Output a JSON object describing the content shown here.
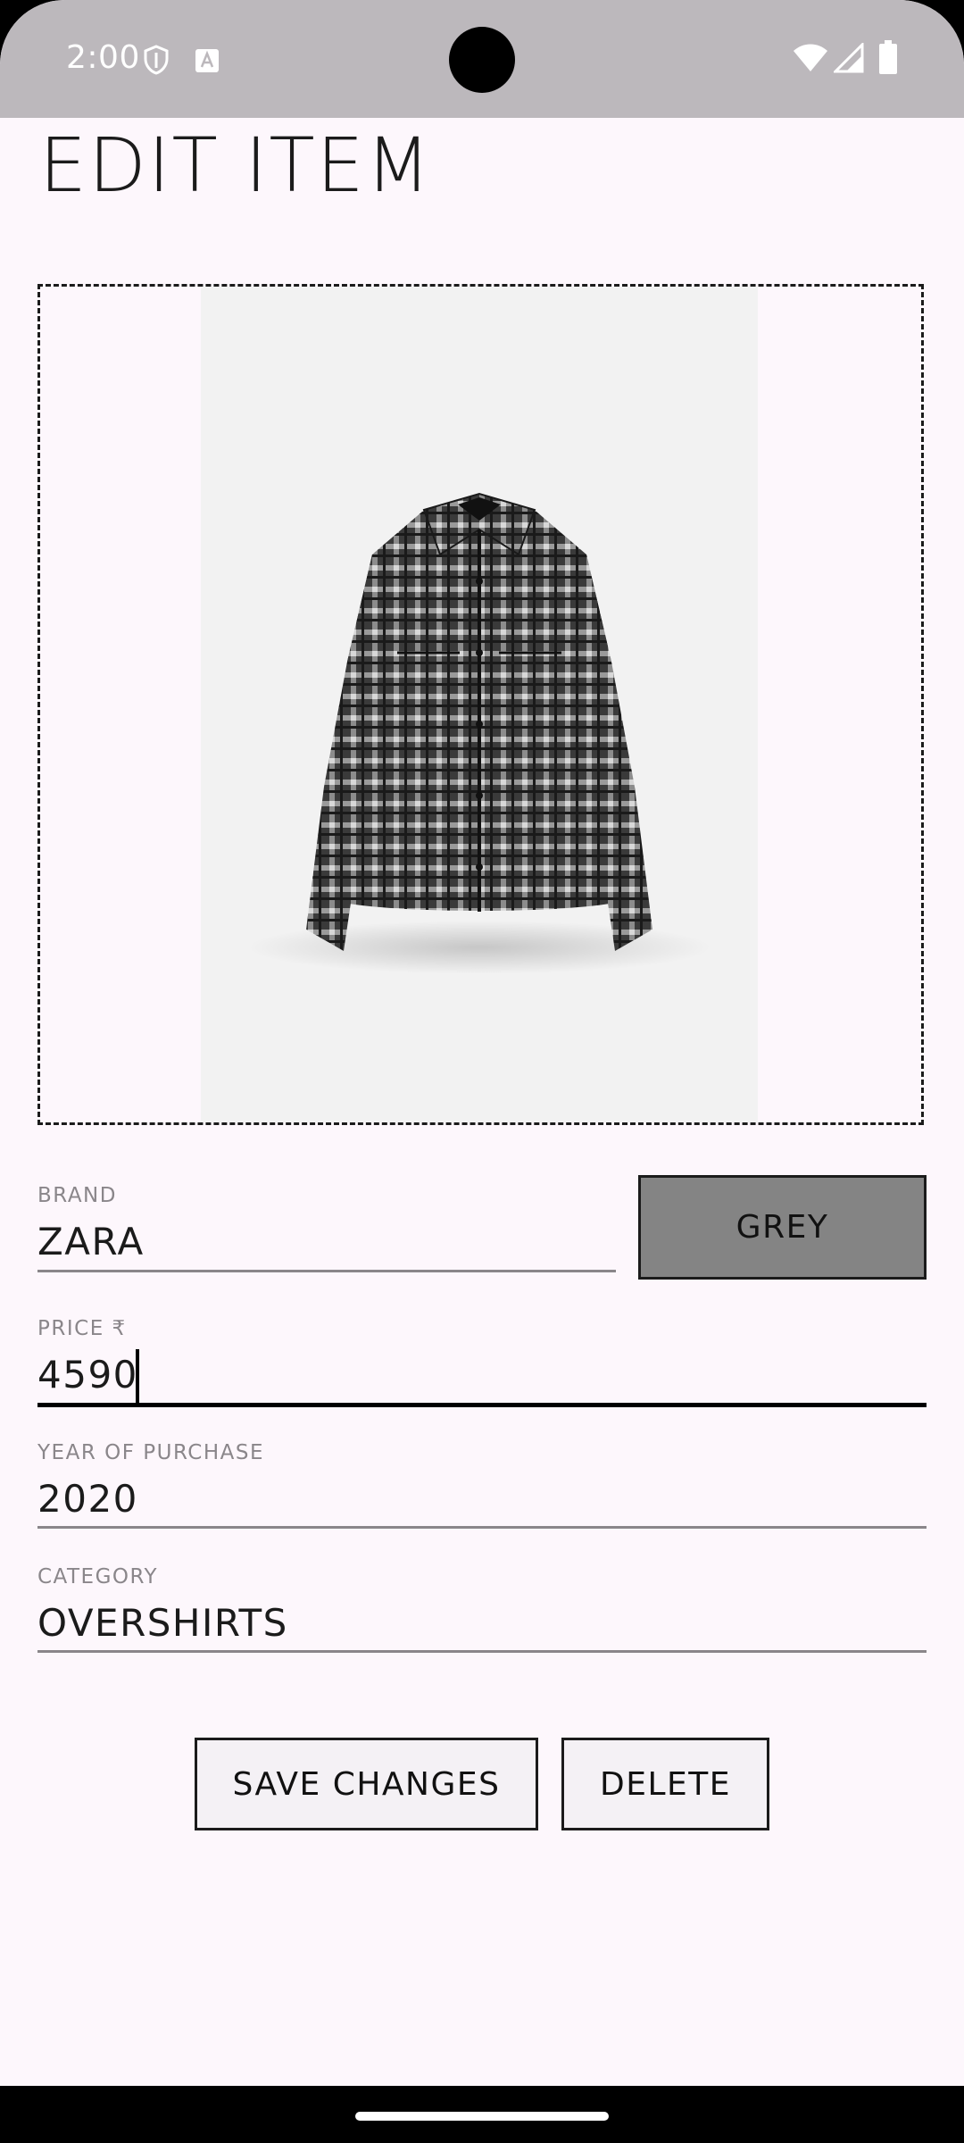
{
  "status_bar": {
    "time": "2:00",
    "icons": [
      "shield-icon",
      "font-a-icon",
      "wifi-icon",
      "signal-icon",
      "battery-icon"
    ]
  },
  "page": {
    "title": "EDIT ITEM"
  },
  "image": {
    "description_icon": "plaid-jacket-photo"
  },
  "form": {
    "brand": {
      "label": "BRAND",
      "value": "ZARA"
    },
    "color_button": {
      "label": "GREY",
      "color": "#848484"
    },
    "price": {
      "label": "PRICE ₹",
      "value": "4590"
    },
    "year": {
      "label": "YEAR OF PURCHASE",
      "value": "2020"
    },
    "category": {
      "label": "CATEGORY",
      "value": "OVERSHIRTS"
    }
  },
  "actions": {
    "save_label": "SAVE CHANGES",
    "delete_label": "DELETE"
  },
  "colors": {
    "background": "#fdf7fc",
    "status_bar": "#bcb8bc",
    "text": "#1b1b1b",
    "muted": "#8a868a"
  }
}
